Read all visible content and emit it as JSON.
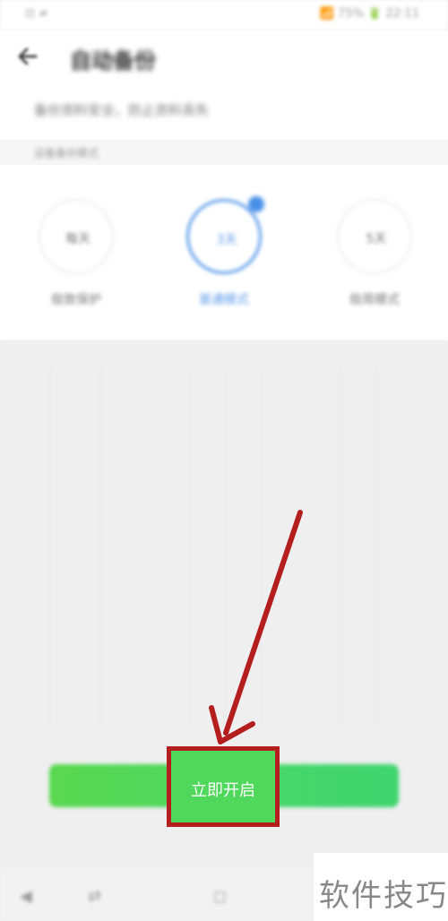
{
  "status_bar": {
    "left": "⊡ ≠",
    "right": "📶 75% 🔋 22:11"
  },
  "header": {
    "title": "自动备份"
  },
  "subtitle": "备份资料安全，防止资料丢失",
  "section_label": "设备备份模式",
  "modes": [
    {
      "circle_text": "每天",
      "label": "极致保护",
      "active": false
    },
    {
      "circle_text": "3天",
      "label": "普通模式",
      "active": true
    },
    {
      "circle_text": "5天",
      "label": "极简模式",
      "active": false
    }
  ],
  "cta": {
    "label": "立即开启"
  },
  "bottom_nav": {
    "back": "◀",
    "swap": "⇄",
    "home": "◻"
  },
  "watermark": "软件技巧",
  "colors": {
    "annotation_red": "#b51e1e",
    "cta_green": "#4fd85c",
    "accent_blue": "#5b9be9"
  }
}
